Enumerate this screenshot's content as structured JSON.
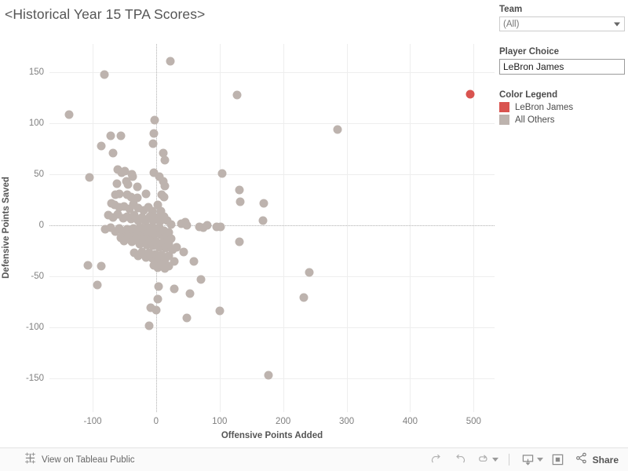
{
  "viz": {
    "title": "<Historical Year 15 TPA Scores>"
  },
  "controls": {
    "team": {
      "label": "Team",
      "value": "(All)",
      "caret_icon": "chevron-down-icon"
    },
    "player_choice": {
      "label": "Player Choice",
      "value": "LeBron James"
    },
    "color_legend": {
      "label": "Color Legend",
      "items": [
        {
          "label": "LeBron James",
          "color": "#d9534f"
        },
        {
          "label": "All Others",
          "color": "#bdb3ae"
        }
      ]
    }
  },
  "toolbar": {
    "tableau_public_label": "View on Tableau Public",
    "tableau_logo_icon": "tableau-logo-icon",
    "buttons": [
      {
        "name": "redo-button",
        "icon": "redo-icon"
      },
      {
        "name": "undo-button",
        "icon": "undo-icon"
      },
      {
        "name": "revert-button",
        "icon": "revert-icon"
      },
      {
        "name": "revert-dropdown-button",
        "icon": "chevron-down-icon"
      },
      {
        "name": "download-button",
        "icon": "download-icon"
      },
      {
        "name": "download-dropdown-button",
        "icon": "chevron-down-icon"
      },
      {
        "name": "fullscreen-button",
        "icon": "fullscreen-icon"
      }
    ],
    "share_label": "Share",
    "share_icon": "share-icon"
  },
  "chart_data": {
    "type": "scatter",
    "title": "<Historical Year 15 TPA Scores>",
    "xlabel": "Offensive Points Added",
    "ylabel": "Defensive Points Saved",
    "xlim": [
      -168,
      533
    ],
    "ylim": [
      -183,
      178
    ],
    "xticks": [
      -100,
      0,
      100,
      200,
      300,
      400,
      500
    ],
    "yticks": [
      150,
      100,
      50,
      0,
      -50,
      -100,
      -150
    ],
    "grid": true,
    "zero_reference_lines": {
      "x": 0,
      "y": 0
    },
    "marker_size_px": 11,
    "legend_position": "right-panel",
    "series": [
      {
        "name": "LeBron James",
        "color": "#d9534f",
        "points": [
          [
            495,
            129
          ]
        ]
      },
      {
        "name": "All Others",
        "color": "#bdb3ae",
        "points": [
          [
            22,
            161
          ],
          [
            -82,
            148
          ],
          [
            -137,
            109
          ],
          [
            127,
            128
          ],
          [
            286,
            94
          ],
          [
            -2,
            103
          ],
          [
            -3,
            90
          ],
          [
            -72,
            88
          ],
          [
            -56,
            88
          ],
          [
            -5,
            80
          ],
          [
            -87,
            78
          ],
          [
            -68,
            71
          ],
          [
            11,
            71
          ],
          [
            14,
            64
          ],
          [
            -105,
            47
          ],
          [
            -60,
            55
          ],
          [
            -54,
            52
          ],
          [
            -49,
            53
          ],
          [
            -38,
            50
          ],
          [
            -37,
            48
          ],
          [
            -4,
            52
          ],
          [
            5,
            48
          ],
          [
            104,
            51
          ],
          [
            -62,
            41
          ],
          [
            -47,
            43
          ],
          [
            -44,
            40
          ],
          [
            -30,
            38
          ],
          [
            11,
            43
          ],
          [
            14,
            39
          ],
          [
            131,
            35
          ],
          [
            -64,
            30
          ],
          [
            -58,
            31
          ],
          [
            -45,
            30
          ],
          [
            -39,
            28
          ],
          [
            -30,
            27
          ],
          [
            -16,
            31
          ],
          [
            9,
            30
          ],
          [
            13,
            28
          ],
          [
            132,
            23
          ],
          [
            170,
            22
          ],
          [
            -70,
            22
          ],
          [
            -66,
            20
          ],
          [
            -58,
            18
          ],
          [
            -50,
            19
          ],
          [
            -42,
            16
          ],
          [
            -36,
            21
          ],
          [
            -28,
            17
          ],
          [
            -20,
            15
          ],
          [
            -12,
            18
          ],
          [
            -6,
            14
          ],
          [
            2,
            20
          ],
          [
            7,
            14
          ],
          [
            -75,
            10
          ],
          [
            -68,
            8
          ],
          [
            -60,
            11
          ],
          [
            -52,
            7
          ],
          [
            -46,
            9
          ],
          [
            -40,
            6
          ],
          [
            -34,
            10
          ],
          [
            -28,
            5
          ],
          [
            -22,
            8
          ],
          [
            -17,
            4
          ],
          [
            -10,
            9
          ],
          [
            -5,
            5
          ],
          [
            1,
            8
          ],
          [
            6,
            4
          ],
          [
            12,
            9
          ],
          [
            18,
            5
          ],
          [
            24,
            1
          ],
          [
            40,
            2
          ],
          [
            46,
            3
          ],
          [
            48,
            0
          ],
          [
            68,
            -1
          ],
          [
            74,
            -2
          ],
          [
            80,
            0
          ],
          [
            95,
            -1
          ],
          [
            101,
            -1
          ],
          [
            168,
            5
          ],
          [
            -80,
            -4
          ],
          [
            -72,
            -2
          ],
          [
            -64,
            -6
          ],
          [
            -58,
            -3
          ],
          [
            -52,
            -7
          ],
          [
            -46,
            -4
          ],
          [
            -40,
            -8
          ],
          [
            -36,
            -3
          ],
          [
            -30,
            -7
          ],
          [
            -26,
            -2
          ],
          [
            -22,
            -9
          ],
          [
            -18,
            -4
          ],
          [
            -14,
            -8
          ],
          [
            -10,
            -2
          ],
          [
            -7,
            -6
          ],
          [
            -4,
            -10
          ],
          [
            -1,
            -3
          ],
          [
            2,
            -7
          ],
          [
            5,
            -2
          ],
          [
            8,
            -9
          ],
          [
            12,
            -5
          ],
          [
            16,
            -11
          ],
          [
            20,
            -7
          ],
          [
            24,
            -13
          ],
          [
            -56,
            -12
          ],
          [
            -50,
            -15
          ],
          [
            -44,
            -11
          ],
          [
            -38,
            -16
          ],
          [
            -32,
            -13
          ],
          [
            -26,
            -18
          ],
          [
            -20,
            -14
          ],
          [
            -15,
            -19
          ],
          [
            -10,
            -15
          ],
          [
            -5,
            -20
          ],
          [
            0,
            -16
          ],
          [
            5,
            -21
          ],
          [
            10,
            -17
          ],
          [
            15,
            -22
          ],
          [
            20,
            -18
          ],
          [
            26,
            -24
          ],
          [
            32,
            -21
          ],
          [
            131,
            -16
          ],
          [
            -34,
            -27
          ],
          [
            -28,
            -30
          ],
          [
            -22,
            -26
          ],
          [
            -16,
            -31
          ],
          [
            -11,
            -27
          ],
          [
            -6,
            -32
          ],
          [
            -1,
            -28
          ],
          [
            4,
            -33
          ],
          [
            9,
            -29
          ],
          [
            14,
            -34
          ],
          [
            20,
            -30
          ],
          [
            28,
            -35
          ],
          [
            44,
            -26
          ],
          [
            -107,
            -39
          ],
          [
            -86,
            -40
          ],
          [
            -3,
            -39
          ],
          [
            2,
            -41
          ],
          [
            8,
            -38
          ],
          [
            14,
            -42
          ],
          [
            20,
            -40
          ],
          [
            60,
            -35
          ],
          [
            241,
            -46
          ],
          [
            -92,
            -58
          ],
          [
            70,
            -53
          ],
          [
            4,
            -60
          ],
          [
            28,
            -62
          ],
          [
            3,
            -72
          ],
          [
            53,
            -67
          ],
          [
            232,
            -71
          ],
          [
            0,
            -83
          ],
          [
            -8,
            -81
          ],
          [
            100,
            -84
          ],
          [
            48,
            -91
          ],
          [
            -11,
            -98
          ],
          [
            177,
            -147
          ]
        ]
      }
    ]
  }
}
